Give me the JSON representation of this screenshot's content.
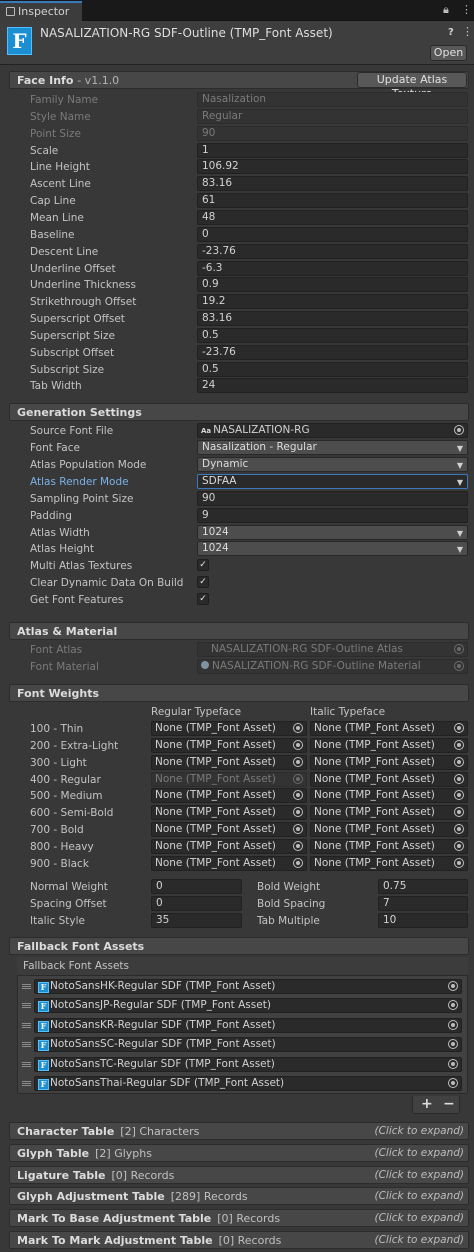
{
  "tab": {
    "title": "Inspector"
  },
  "header": {
    "title": "NASALIZATION-RG SDF-Outline (TMP_Font Asset)",
    "icon_letter": "F",
    "open_label": "Open"
  },
  "face_info": {
    "title": "Face Info",
    "version": "- v1.1.0",
    "update_button": "Update Atlas Texture",
    "rows": [
      {
        "label": "Family Name",
        "value": "Nasalization",
        "disabled": true
      },
      {
        "label": "Style Name",
        "value": "Regular",
        "disabled": true
      },
      {
        "label": "Point Size",
        "value": "90",
        "disabled": true
      },
      {
        "label": "Scale",
        "value": "1"
      },
      {
        "label": "Line Height",
        "value": "106.92"
      },
      {
        "label": "Ascent Line",
        "value": "83.16"
      },
      {
        "label": "Cap Line",
        "value": "61"
      },
      {
        "label": "Mean Line",
        "value": "48"
      },
      {
        "label": "Baseline",
        "value": "0"
      },
      {
        "label": "Descent Line",
        "value": "-23.76"
      },
      {
        "label": "Underline Offset",
        "value": "-6.3"
      },
      {
        "label": "Underline Thickness",
        "value": "0.9"
      },
      {
        "label": "Strikethrough Offset",
        "value": "19.2"
      },
      {
        "label": "Superscript Offset",
        "value": "83.16"
      },
      {
        "label": "Superscript Size",
        "value": "0.5"
      },
      {
        "label": "Subscript Offset",
        "value": "-23.76"
      },
      {
        "label": "Subscript Size",
        "value": "0.5"
      },
      {
        "label": "Tab Width",
        "value": "24"
      }
    ]
  },
  "generation": {
    "title": "Generation Settings",
    "source_font_label": "Source Font File",
    "source_font_icon": "Aa",
    "source_font_value": "NASALIZATION-RG",
    "font_face_label": "Font Face",
    "font_face_value": "Nasalization - Regular",
    "population_label": "Atlas Population Mode",
    "population_value": "Dynamic",
    "render_label": "Atlas Render Mode",
    "render_value": "SDFAA",
    "sampling_label": "Sampling Point Size",
    "sampling_value": "90",
    "padding_label": "Padding",
    "padding_value": "9",
    "width_label": "Atlas Width",
    "width_value": "1024",
    "height_label": "Atlas Height",
    "height_value": "1024",
    "multi_label": "Multi Atlas Textures",
    "clear_label": "Clear Dynamic Data On Build",
    "features_label": "Get Font Features",
    "check_mark": "✓"
  },
  "atlas_material": {
    "title": "Atlas & Material",
    "atlas_label": "Font Atlas",
    "atlas_value": "NASALIZATION-RG SDF-Outline Atlas",
    "material_label": "Font Material",
    "material_value": "NASALIZATION-RG SDF-Outline Material"
  },
  "font_weights": {
    "title": "Font Weights",
    "regular_header": "Regular Typeface",
    "italic_header": "Italic Typeface",
    "rows": [
      {
        "label": "100 - Thin",
        "regular": "None (TMP_Font Asset)",
        "italic": "None (TMP_Font Asset)"
      },
      {
        "label": "200 - Extra-Light",
        "regular": "None (TMP_Font Asset)",
        "italic": "None (TMP_Font Asset)"
      },
      {
        "label": "300 - Light",
        "regular": "None (TMP_Font Asset)",
        "italic": "None (TMP_Font Asset)"
      },
      {
        "label": "400 - Regular",
        "regular": "None (TMP_Font Asset)",
        "italic": "None (TMP_Font Asset)",
        "regular_disabled": true
      },
      {
        "label": "500 - Medium",
        "regular": "None (TMP_Font Asset)",
        "italic": "None (TMP_Font Asset)"
      },
      {
        "label": "600 - Semi-Bold",
        "regular": "None (TMP_Font Asset)",
        "italic": "None (TMP_Font Asset)"
      },
      {
        "label": "700 - Bold",
        "regular": "None (TMP_Font Asset)",
        "italic": "None (TMP_Font Asset)"
      },
      {
        "label": "800 - Heavy",
        "regular": "None (TMP_Font Asset)",
        "italic": "None (TMP_Font Asset)"
      },
      {
        "label": "900 - Black",
        "regular": "None (TMP_Font Asset)",
        "italic": "None (TMP_Font Asset)"
      }
    ],
    "normal_weight_label": "Normal Weight",
    "normal_weight_value": "0",
    "bold_weight_label": "Bold Weight",
    "bold_weight_value": "0.75",
    "spacing_offset_label": "Spacing Offset",
    "spacing_offset_value": "0",
    "bold_spacing_label": "Bold Spacing",
    "bold_spacing_value": "7",
    "italic_style_label": "Italic Style",
    "italic_style_value": "35",
    "tab_multiple_label": "Tab Multiple",
    "tab_multiple_value": "10"
  },
  "fallback": {
    "title": "Fallback Font Assets",
    "list_header": "Fallback Font Assets",
    "items": [
      "NotoSansHK-Regular SDF (TMP_Font Asset)",
      "NotoSansJP-Regular SDF (TMP_Font Asset)",
      "NotoSansKR-Regular SDF (TMP_Font Asset)",
      "NotoSansSC-Regular SDF (TMP_Font Asset)",
      "NotoSansTC-Regular SDF (TMP_Font Asset)",
      "NotoSansThai-Regular SDF (TMP_Font Asset)"
    ],
    "add_label": "+",
    "remove_label": "−"
  },
  "tables": [
    {
      "title": "Character Table",
      "count": "[2] Characters",
      "hint": "(Click to expand)"
    },
    {
      "title": "Glyph Table",
      "count": "[2] Glyphs",
      "hint": "(Click to expand)"
    },
    {
      "title": "Ligature Table",
      "count": "[0] Records",
      "hint": "(Click to expand)"
    },
    {
      "title": "Glyph Adjustment Table",
      "count": "[289] Records",
      "hint": "(Click to expand)"
    },
    {
      "title": "Mark To Base Adjustment Table",
      "count": "[0] Records",
      "hint": "(Click to expand)"
    },
    {
      "title": "Mark To Mark Adjustment Table",
      "count": "[0] Records",
      "hint": "(Click to expand)"
    }
  ]
}
